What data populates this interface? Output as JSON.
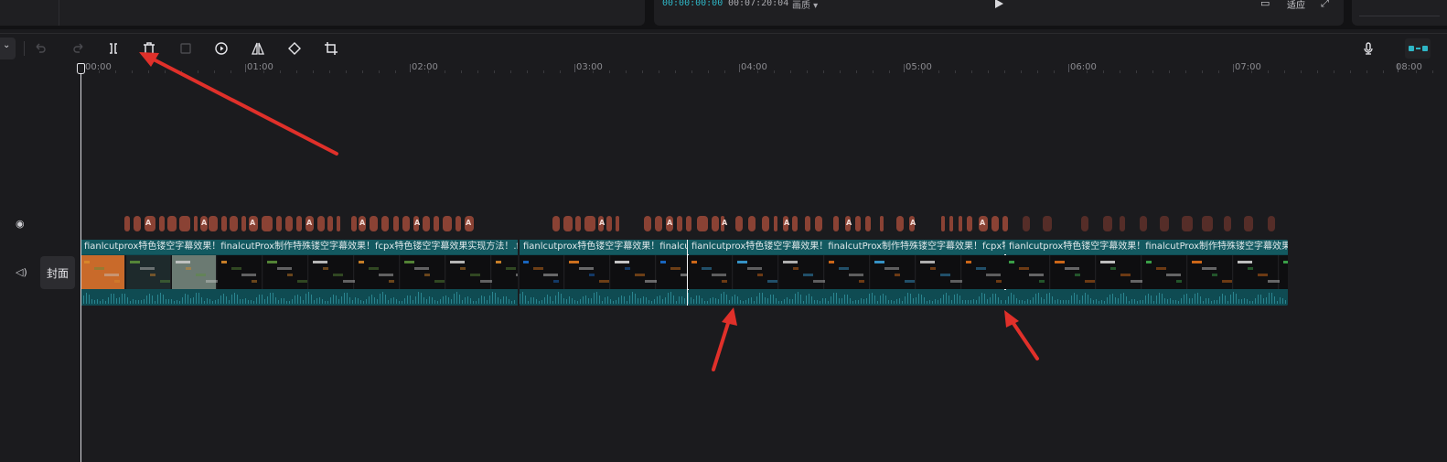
{
  "player": {
    "current_time": "00:00:00:00",
    "total_time": "00:07:20:04",
    "quality_label": "画质 ▾",
    "icons": [
      "play-icon",
      "waveform-icon",
      "fit-icon",
      "fullscreen-icon"
    ],
    "fit_label": "适应"
  },
  "toolbar": {
    "menu_icon": "chevron-down-icon",
    "buttons": [
      {
        "name": "undo-button",
        "icon": "undo-icon"
      },
      {
        "name": "redo-button",
        "icon": "redo-icon"
      },
      {
        "name": "split-button",
        "icon": "split-icon"
      },
      {
        "name": "delete-button",
        "icon": "trash-icon"
      },
      {
        "name": "freeze-button",
        "icon": "freeze-icon"
      },
      {
        "name": "reverse-button",
        "icon": "reverse-play-icon"
      },
      {
        "name": "mirror-button",
        "icon": "mirror-icon"
      },
      {
        "name": "rotate-button",
        "icon": "rotate-icon"
      },
      {
        "name": "crop-button",
        "icon": "crop-icon"
      }
    ],
    "right": [
      {
        "name": "microphone-button",
        "icon": "microphone-icon"
      },
      {
        "name": "timeline-link-toggle",
        "icon": "link-toggle-icon"
      }
    ]
  },
  "ruler": {
    "labels": [
      "00:00",
      "01:00",
      "02:00",
      "03:00",
      "04:00",
      "05:00",
      "06:00",
      "07:00",
      "08:00"
    ]
  },
  "tracks": {
    "caption_track": {
      "visibility_icon": "eye-icon"
    },
    "video_track": {
      "audio_icon": "speaker-icon",
      "cover_label": "封面",
      "clips": [
        {
          "title": "fianlcutprox特色镂空字幕效果！finalcutProx制作特殊镂空字幕效果！fcpx特色镂空字幕效果实现方法！.flv",
          "selected": false
        },
        {
          "title": "fianlcutprox特色镂空字幕效果！finalcutProx制作特殊镂空字幕效果！fcpx特色镂空字幕效果实现方法！.flv",
          "selected": false
        },
        {
          "title": "fianlcutprox特色镂空字幕效果！finalcutProx制作特殊镂空字幕效果！fcpx特色镂空字幕效果实现方法！.flv",
          "selected": true
        },
        {
          "title": "fianlcutprox特色镂空字幕效果！finalcutProx制作特殊镂空字幕效果！fcpx特色镂空字幕效果实现方法！.flv",
          "selected": false
        }
      ]
    }
  },
  "caption_glyph": "A",
  "colors": {
    "accent": "#2fb6c6",
    "caption_clip": "#8a4234",
    "video_track": "#0f4b52",
    "selection": "#f2f2f4",
    "annotation_arrow": "#e0302a"
  }
}
